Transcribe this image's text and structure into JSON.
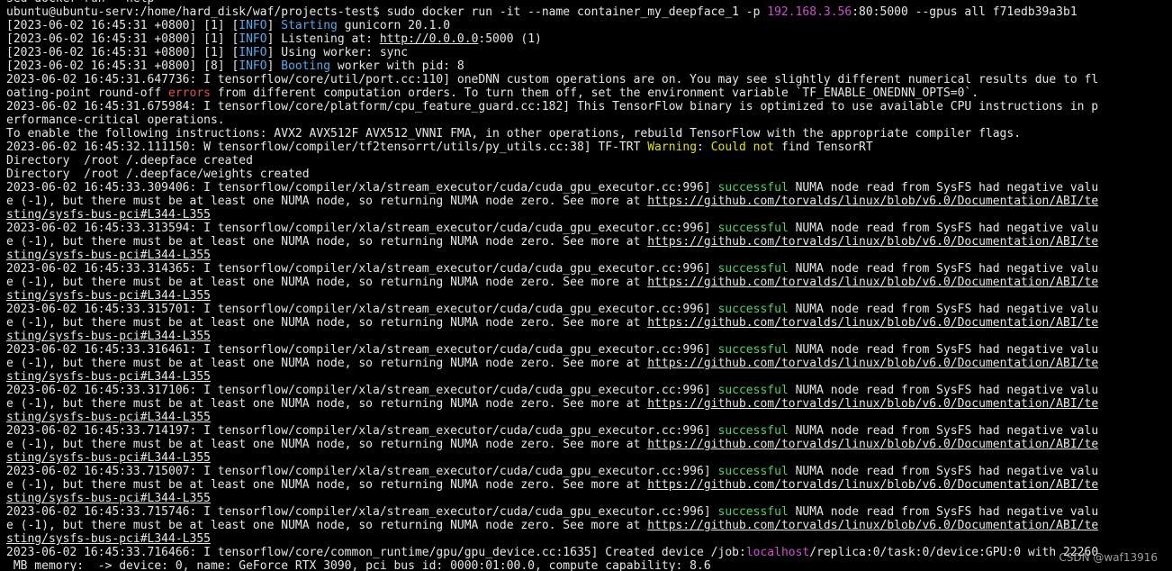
{
  "terminal": {
    "watermark": "CSDN @waf13916",
    "lines": [
      [
        [
          "sed docker run --help",
          ""
        ]
      ],
      [
        [
          "ubuntu@ubuntu-serv:/home/hard_disk/waf/projects-test$ sudo docker run -it --name container_my_deepface_1 -p ",
          ""
        ],
        [
          "192.168.3.56",
          "magenta"
        ],
        [
          ":80:5000 --gpus all f71edb39a3b1",
          ""
        ]
      ],
      [
        [
          "[2023-06-02 16:45:31 +0800] [1] [",
          ""
        ],
        [
          "INFO",
          "cyan"
        ],
        [
          "] ",
          ""
        ],
        [
          "Starting",
          "cyan"
        ],
        [
          " gunicorn 20.1.0",
          ""
        ]
      ],
      [
        [
          "[2023-06-02 16:45:31 +0800] [1] [",
          ""
        ],
        [
          "INFO",
          "cyan"
        ],
        [
          "] Listening at: ",
          ""
        ],
        [
          "http://0.0.0.0",
          "underline"
        ],
        [
          ":5000 (1)",
          ""
        ]
      ],
      [
        [
          "[2023-06-02 16:45:31 +0800] [1] [",
          ""
        ],
        [
          "INFO",
          "cyan"
        ],
        [
          "] Using worker: sync",
          ""
        ]
      ],
      [
        [
          "[2023-06-02 16:45:31 +0800] [8] [",
          ""
        ],
        [
          "INFO",
          "cyan"
        ],
        [
          "] ",
          ""
        ],
        [
          "Booting",
          "cyan"
        ],
        [
          " worker with pid: 8",
          ""
        ]
      ],
      [
        [
          "2023-06-02 16:45:31.647736: I tensorflow/core/util/port.cc:110] oneDNN custom operations are on. You may see slightly different numerical results due to fl",
          ""
        ]
      ],
      [
        [
          "oating-point round-off ",
          ""
        ],
        [
          "errors",
          "red"
        ],
        [
          " from different computation orders. To turn them off, set the environment variable `TF_ENABLE_ONEDNN_OPTS=0`.",
          ""
        ]
      ],
      [
        [
          "2023-06-02 16:45:31.675984: I tensorflow/core/platform/cpu_feature_guard.cc:182] This TensorFlow binary is optimized to use available CPU instructions in p",
          ""
        ]
      ],
      [
        [
          "erformance-critical operations.",
          ""
        ]
      ],
      [
        [
          "To enable the following instructions: AVX2 AVX512F AVX512_VNNI FMA, in other operations, rebuild TensorFlow with the appropriate compiler flags.",
          ""
        ]
      ],
      [
        [
          "2023-06-02 16:45:32.111150: W tensorflow/compiler/tf2tensorrt/utils/py_utils.cc:38] TF-TRT ",
          ""
        ],
        [
          "Warning",
          "yellow"
        ],
        [
          ": ",
          ""
        ],
        [
          "Could not",
          "yellow"
        ],
        [
          " find TensorRT",
          ""
        ]
      ],
      [
        [
          "Directory  /root /.deepface created",
          ""
        ]
      ],
      [
        [
          "Directory  /root /.deepface/weights created",
          ""
        ]
      ],
      [
        [
          "2023-06-02 16:45:33.309406: I tensorflow/compiler/xla/stream_executor/cuda/cuda_gpu_executor.cc:996] ",
          ""
        ],
        [
          "successful",
          "green"
        ],
        [
          " NUMA node read from SysFS had negative valu",
          ""
        ]
      ],
      [
        [
          "e (-1), but there must be at least one NUMA node, so returning NUMA node zero. See more at ",
          ""
        ],
        [
          "https://github.com/torvalds/linux/blob/v6.0/Documentation/ABI/te",
          "underline"
        ]
      ],
      [
        [
          "sting/sysfs-bus-pci#L344-L355",
          "underline"
        ]
      ],
      [
        [
          "2023-06-02 16:45:33.313594: I tensorflow/compiler/xla/stream_executor/cuda/cuda_gpu_executor.cc:996] ",
          ""
        ],
        [
          "successful",
          "green"
        ],
        [
          " NUMA node read from SysFS had negative valu",
          ""
        ]
      ],
      [
        [
          "e (-1), but there must be at least one NUMA node, so returning NUMA node zero. See more at ",
          ""
        ],
        [
          "https://github.com/torvalds/linux/blob/v6.0/Documentation/ABI/te",
          "underline"
        ]
      ],
      [
        [
          "sting/sysfs-bus-pci#L344-L355",
          "underline"
        ]
      ],
      [
        [
          "2023-06-02 16:45:33.314365: I tensorflow/compiler/xla/stream_executor/cuda/cuda_gpu_executor.cc:996] ",
          ""
        ],
        [
          "successful",
          "green"
        ],
        [
          " NUMA node read from SysFS had negative valu",
          ""
        ]
      ],
      [
        [
          "e (-1), but there must be at least one NUMA node, so returning NUMA node zero. See more at ",
          ""
        ],
        [
          "https://github.com/torvalds/linux/blob/v6.0/Documentation/ABI/te",
          "underline"
        ]
      ],
      [
        [
          "sting/sysfs-bus-pci#L344-L355",
          "underline"
        ]
      ],
      [
        [
          "2023-06-02 16:45:33.315701: I tensorflow/compiler/xla/stream_executor/cuda/cuda_gpu_executor.cc:996] ",
          ""
        ],
        [
          "successful",
          "green"
        ],
        [
          " NUMA node read from SysFS had negative valu",
          ""
        ]
      ],
      [
        [
          "e (-1), but there must be at least one NUMA node, so returning NUMA node zero. See more at ",
          ""
        ],
        [
          "https://github.com/torvalds/linux/blob/v6.0/Documentation/ABI/te",
          "underline"
        ]
      ],
      [
        [
          "sting/sysfs-bus-pci#L344-L355",
          "underline"
        ]
      ],
      [
        [
          "2023-06-02 16:45:33.316461: I tensorflow/compiler/xla/stream_executor/cuda/cuda_gpu_executor.cc:996] ",
          ""
        ],
        [
          "successful",
          "green"
        ],
        [
          " NUMA node read from SysFS had negative valu",
          ""
        ]
      ],
      [
        [
          "e (-1), but there must be at least one NUMA node, so returning NUMA node zero. See more at ",
          ""
        ],
        [
          "https://github.com/torvalds/linux/blob/v6.0/Documentation/ABI/te",
          "underline"
        ]
      ],
      [
        [
          "sting/sysfs-bus-pci#L344-L355",
          "underline"
        ]
      ],
      [
        [
          "2023-06-02 16:45:33.317106: I tensorflow/compiler/xla/stream_executor/cuda/cuda_gpu_executor.cc:996] ",
          ""
        ],
        [
          "successful",
          "green"
        ],
        [
          " NUMA node read from SysFS had negative valu",
          ""
        ]
      ],
      [
        [
          "e (-1), but there must be at least one NUMA node, so returning NUMA node zero. See more at ",
          ""
        ],
        [
          "https://github.com/torvalds/linux/blob/v6.0/Documentation/ABI/te",
          "underline"
        ]
      ],
      [
        [
          "sting/sysfs-bus-pci#L344-L355",
          "underline"
        ]
      ],
      [
        [
          "2023-06-02 16:45:33.714197: I tensorflow/compiler/xla/stream_executor/cuda/cuda_gpu_executor.cc:996] ",
          ""
        ],
        [
          "successful",
          "green"
        ],
        [
          " NUMA node read from SysFS had negative valu",
          ""
        ]
      ],
      [
        [
          "e (-1), but there must be at least one NUMA node, so returning NUMA node zero. See more at ",
          ""
        ],
        [
          "https://github.com/torvalds/linux/blob/v6.0/Documentation/ABI/te",
          "underline"
        ]
      ],
      [
        [
          "sting/sysfs-bus-pci#L344-L355",
          "underline"
        ]
      ],
      [
        [
          "2023-06-02 16:45:33.715007: I tensorflow/compiler/xla/stream_executor/cuda/cuda_gpu_executor.cc:996] ",
          ""
        ],
        [
          "successful",
          "green"
        ],
        [
          " NUMA node read from SysFS had negative valu",
          ""
        ]
      ],
      [
        [
          "e (-1), but there must be at least one NUMA node, so returning NUMA node zero. See more at ",
          ""
        ],
        [
          "https://github.com/torvalds/linux/blob/v6.0/Documentation/ABI/te",
          "underline"
        ]
      ],
      [
        [
          "sting/sysfs-bus-pci#L344-L355",
          "underline"
        ]
      ],
      [
        [
          "2023-06-02 16:45:33.715746: I tensorflow/compiler/xla/stream_executor/cuda/cuda_gpu_executor.cc:996] ",
          ""
        ],
        [
          "successful",
          "green"
        ],
        [
          " NUMA node read from SysFS had negative valu",
          ""
        ]
      ],
      [
        [
          "e (-1), but there must be at least one NUMA node, so returning NUMA node zero. See more at ",
          ""
        ],
        [
          "https://github.com/torvalds/linux/blob/v6.0/Documentation/ABI/te",
          "underline"
        ]
      ],
      [
        [
          "sting/sysfs-bus-pci#L344-L355",
          "underline"
        ]
      ],
      [
        [
          "2023-06-02 16:45:33.716466: I tensorflow/core/common_runtime/gpu/gpu_device.cc:1635] Created device /job:",
          ""
        ],
        [
          "localhost",
          "magenta"
        ],
        [
          "/replica:0/task:0/device:GPU:0 with 22260",
          ""
        ]
      ],
      [
        [
          " MB memory:  -> device: 0, name: GeForce RTX 3090, pci bus id: 0000:01:00.0, compute capability: 8.6",
          ""
        ]
      ]
    ]
  }
}
